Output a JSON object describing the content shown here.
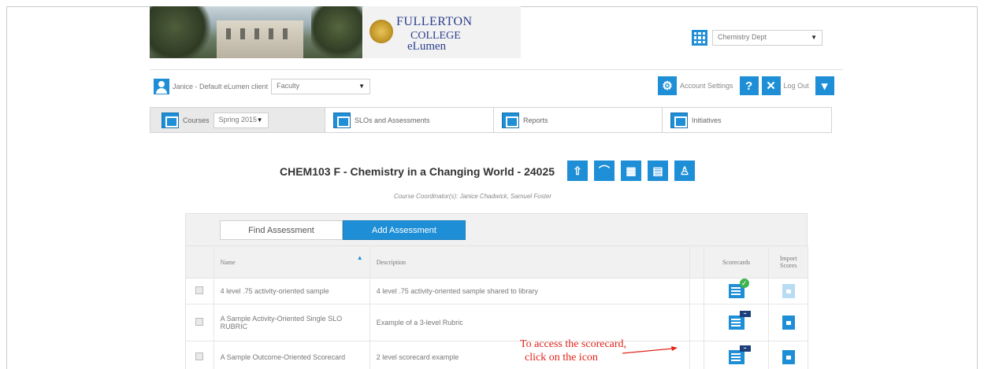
{
  "header": {
    "logo_line1": "FULLERTON",
    "logo_line2": "COLLEGE",
    "logo_line3": "eLumen",
    "dept_select": "Chemistry Dept"
  },
  "userbar": {
    "user_name": "Janice - Default eLumen client",
    "role_select": "Faculty",
    "account_settings": "Account Settings",
    "help_icon": "?",
    "logout_icon": "✕",
    "logout": "Log Out"
  },
  "nav": {
    "courses_label": "Courses",
    "term_select": "Spring 2015",
    "slos_label": "SLOs and Assessments",
    "reports_label": "Reports",
    "initiatives_label": "Initiatives"
  },
  "course": {
    "title": "CHEM103 F - Chemistry in a Changing World - 24025",
    "coordinator": "Course Coordinator(s): Janice Chadwick, Samuel Foster"
  },
  "tabs": {
    "find": "Find Assessment",
    "add": "Add Assessment"
  },
  "table": {
    "headers": {
      "name": "Name",
      "description": "Description",
      "scorecards": "Scorecards",
      "import_scores": "Import Scores"
    },
    "rows": [
      {
        "name": "4 level .75 activity-oriented sample",
        "description": "4 level .75 activity-oriented sample shared to library",
        "scorecard_state": "check",
        "import_faded": true
      },
      {
        "name": "A Sample Activity-Oriented Single SLO RUBRIC",
        "description": "Example of a 3-level Rubric",
        "scorecard_state": "tag",
        "import_faded": false
      },
      {
        "name": "A Sample Outcome-Oriented Scorecard",
        "description": "2 level scorecard example",
        "scorecard_state": "tag",
        "import_faded": false
      }
    ]
  },
  "annotation": {
    "line1": "To access the scorecard,",
    "line2": "click on the icon",
    "color": "#e0241b"
  },
  "colors": {
    "accent": "#1e8fd6",
    "check": "#3fb34f"
  }
}
